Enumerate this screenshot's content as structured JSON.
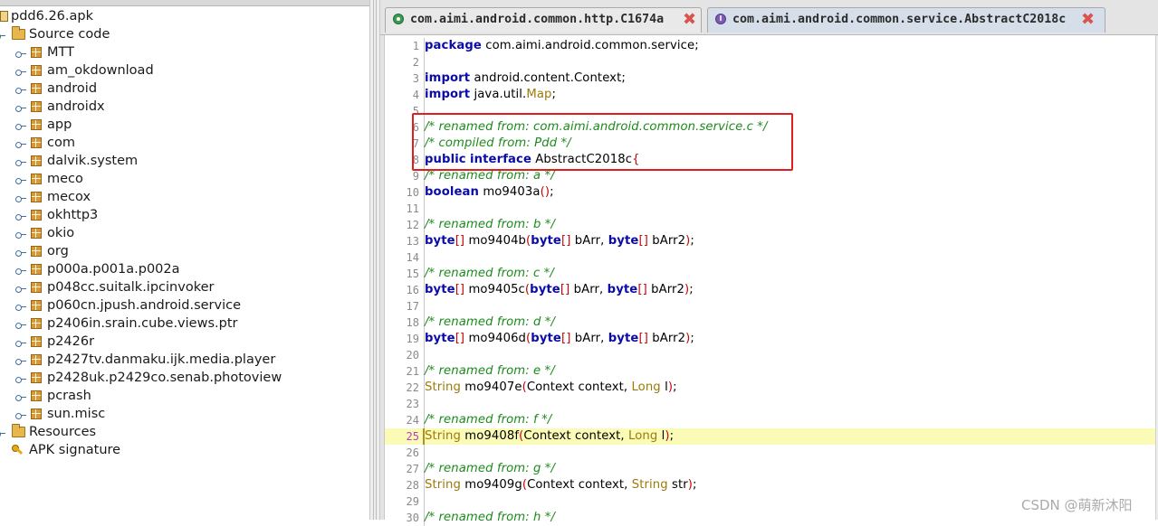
{
  "tree": {
    "root": "pdd6.26.apk",
    "source_code": "Source code",
    "packages": [
      "MTT",
      "am_okdownload",
      "android",
      "androidx",
      "app",
      "com",
      "dalvik.system",
      "meco",
      "mecox",
      "okhttp3",
      "okio",
      "org",
      "p000a.p001a.p002a",
      "p048cc.suitalk.ipcinvoker",
      "p060cn.jpush.android.service",
      "p2406in.srain.cube.views.ptr",
      "p2426r",
      "p2427tv.danmaku.ijk.media.player",
      "p2428uk.p2429co.senab.photoview",
      "pcrash",
      "sun.misc"
    ],
    "resources": "Resources",
    "apk_signature": "APK signature"
  },
  "tabs": [
    {
      "label": "com.aimi.android.common.http.C1674a",
      "close": "✖"
    },
    {
      "label": "com.aimi.android.common.service.AbstractC2018c",
      "close": "✖"
    }
  ],
  "editor": {
    "highlighted_line": 25,
    "lines": [
      {
        "n": "1",
        "t": [
          [
            "kw",
            "package"
          ],
          [
            "",
            "com.aimi.android.common.service;"
          ]
        ]
      },
      {
        "n": "2",
        "t": []
      },
      {
        "n": "3",
        "t": [
          [
            "kw",
            "import"
          ],
          [
            "",
            "android.content.Context;"
          ]
        ]
      },
      {
        "n": "4",
        "t": [
          [
            "kw",
            "import"
          ],
          [
            "",
            "java.util."
          ],
          [
            "ty",
            "Map"
          ],
          [
            "",
            ";"
          ]
        ]
      },
      {
        "n": "5",
        "t": []
      },
      {
        "n": "6",
        "t": [
          [
            "cm",
            "/* renamed from: com.aimi.android.common.service.c */"
          ]
        ]
      },
      {
        "n": "7",
        "t": [
          [
            "cm",
            "/* compiled from: Pdd */"
          ]
        ]
      },
      {
        "n": "8",
        "t": [
          [
            "kw",
            "public"
          ],
          [
            "kw",
            "interface"
          ],
          [
            "",
            "AbstractC2018c"
          ],
          [
            "pu",
            "{"
          ]
        ]
      },
      {
        "n": "9",
        "t": [
          [
            "",
            "  "
          ],
          [
            "cm",
            "/* renamed from: a */"
          ]
        ]
      },
      {
        "n": "10",
        "t": [
          [
            "",
            "  "
          ],
          [
            "kw",
            "boolean"
          ],
          [
            "",
            "mo9403a"
          ],
          [
            "pu",
            "()"
          ],
          [
            "",
            ";"
          ]
        ]
      },
      {
        "n": "11",
        "t": []
      },
      {
        "n": "12",
        "t": [
          [
            "",
            "  "
          ],
          [
            "cm",
            "/* renamed from: b */"
          ]
        ]
      },
      {
        "n": "13",
        "t": [
          [
            "",
            "  "
          ],
          [
            "kw",
            "byte"
          ],
          [
            "pu",
            "[]"
          ],
          [
            "",
            "mo9404b"
          ],
          [
            "pu",
            "("
          ],
          [
            "kw",
            "byte"
          ],
          [
            "pu",
            "[]"
          ],
          [
            "",
            "bArr,"
          ],
          [
            "kw",
            "byte"
          ],
          [
            "pu",
            "[]"
          ],
          [
            "",
            "bArr2"
          ],
          [
            "pu",
            ")"
          ],
          [
            "",
            ";"
          ]
        ]
      },
      {
        "n": "14",
        "t": []
      },
      {
        "n": "15",
        "t": [
          [
            "",
            "  "
          ],
          [
            "cm",
            "/* renamed from: c */"
          ]
        ]
      },
      {
        "n": "16",
        "t": [
          [
            "",
            "  "
          ],
          [
            "kw",
            "byte"
          ],
          [
            "pu",
            "[]"
          ],
          [
            "",
            "mo9405c"
          ],
          [
            "pu",
            "("
          ],
          [
            "kw",
            "byte"
          ],
          [
            "pu",
            "[]"
          ],
          [
            "",
            "bArr,"
          ],
          [
            "kw",
            "byte"
          ],
          [
            "pu",
            "[]"
          ],
          [
            "",
            "bArr2"
          ],
          [
            "pu",
            ")"
          ],
          [
            "",
            ";"
          ]
        ]
      },
      {
        "n": "17",
        "t": []
      },
      {
        "n": "18",
        "t": [
          [
            "",
            "  "
          ],
          [
            "cm",
            "/* renamed from: d */"
          ]
        ]
      },
      {
        "n": "19",
        "t": [
          [
            "",
            "  "
          ],
          [
            "kw",
            "byte"
          ],
          [
            "pu",
            "[]"
          ],
          [
            "",
            "mo9406d"
          ],
          [
            "pu",
            "("
          ],
          [
            "kw",
            "byte"
          ],
          [
            "pu",
            "[]"
          ],
          [
            "",
            "bArr,"
          ],
          [
            "kw",
            "byte"
          ],
          [
            "pu",
            "[]"
          ],
          [
            "",
            "bArr2"
          ],
          [
            "pu",
            ")"
          ],
          [
            "",
            ";"
          ]
        ]
      },
      {
        "n": "20",
        "t": []
      },
      {
        "n": "21",
        "t": [
          [
            "",
            "  "
          ],
          [
            "cm",
            "/* renamed from: e */"
          ]
        ]
      },
      {
        "n": "22",
        "t": [
          [
            "",
            "  "
          ],
          [
            "ty",
            "String"
          ],
          [
            "",
            "mo9407e"
          ],
          [
            "pu",
            "("
          ],
          [
            "",
            "Context context,"
          ],
          [
            "ty",
            "Long"
          ],
          [
            "",
            "l"
          ],
          [
            "pu",
            ")"
          ],
          [
            "",
            ";"
          ]
        ]
      },
      {
        "n": "23",
        "t": []
      },
      {
        "n": "24",
        "t": [
          [
            "",
            "  "
          ],
          [
            "cm",
            "/* renamed from: f */"
          ]
        ]
      },
      {
        "n": "25",
        "t": [
          [
            "",
            "  "
          ],
          [
            "ty",
            "String"
          ],
          [
            "",
            "mo9408f"
          ],
          [
            "pu",
            "("
          ],
          [
            "",
            "Context context,"
          ],
          [
            "ty",
            "Long"
          ],
          [
            "",
            "l"
          ],
          [
            "pu",
            ")"
          ],
          [
            "",
            ";"
          ]
        ]
      },
      {
        "n": "26",
        "t": []
      },
      {
        "n": "27",
        "t": [
          [
            "",
            "  "
          ],
          [
            "cm",
            "/* renamed from: g */"
          ]
        ]
      },
      {
        "n": "28",
        "t": [
          [
            "",
            "  "
          ],
          [
            "ty",
            "String"
          ],
          [
            "",
            "mo9409g"
          ],
          [
            "pu",
            "("
          ],
          [
            "",
            "Context context,"
          ],
          [
            "ty",
            "String"
          ],
          [
            "",
            "str"
          ],
          [
            "pu",
            ")"
          ],
          [
            "",
            ";"
          ]
        ]
      },
      {
        "n": "29",
        "t": []
      },
      {
        "n": "30",
        "t": [
          [
            "",
            "  "
          ],
          [
            "cm",
            "/* renamed from: h */"
          ]
        ]
      }
    ]
  },
  "watermark": "CSDN @萌新沐阳"
}
